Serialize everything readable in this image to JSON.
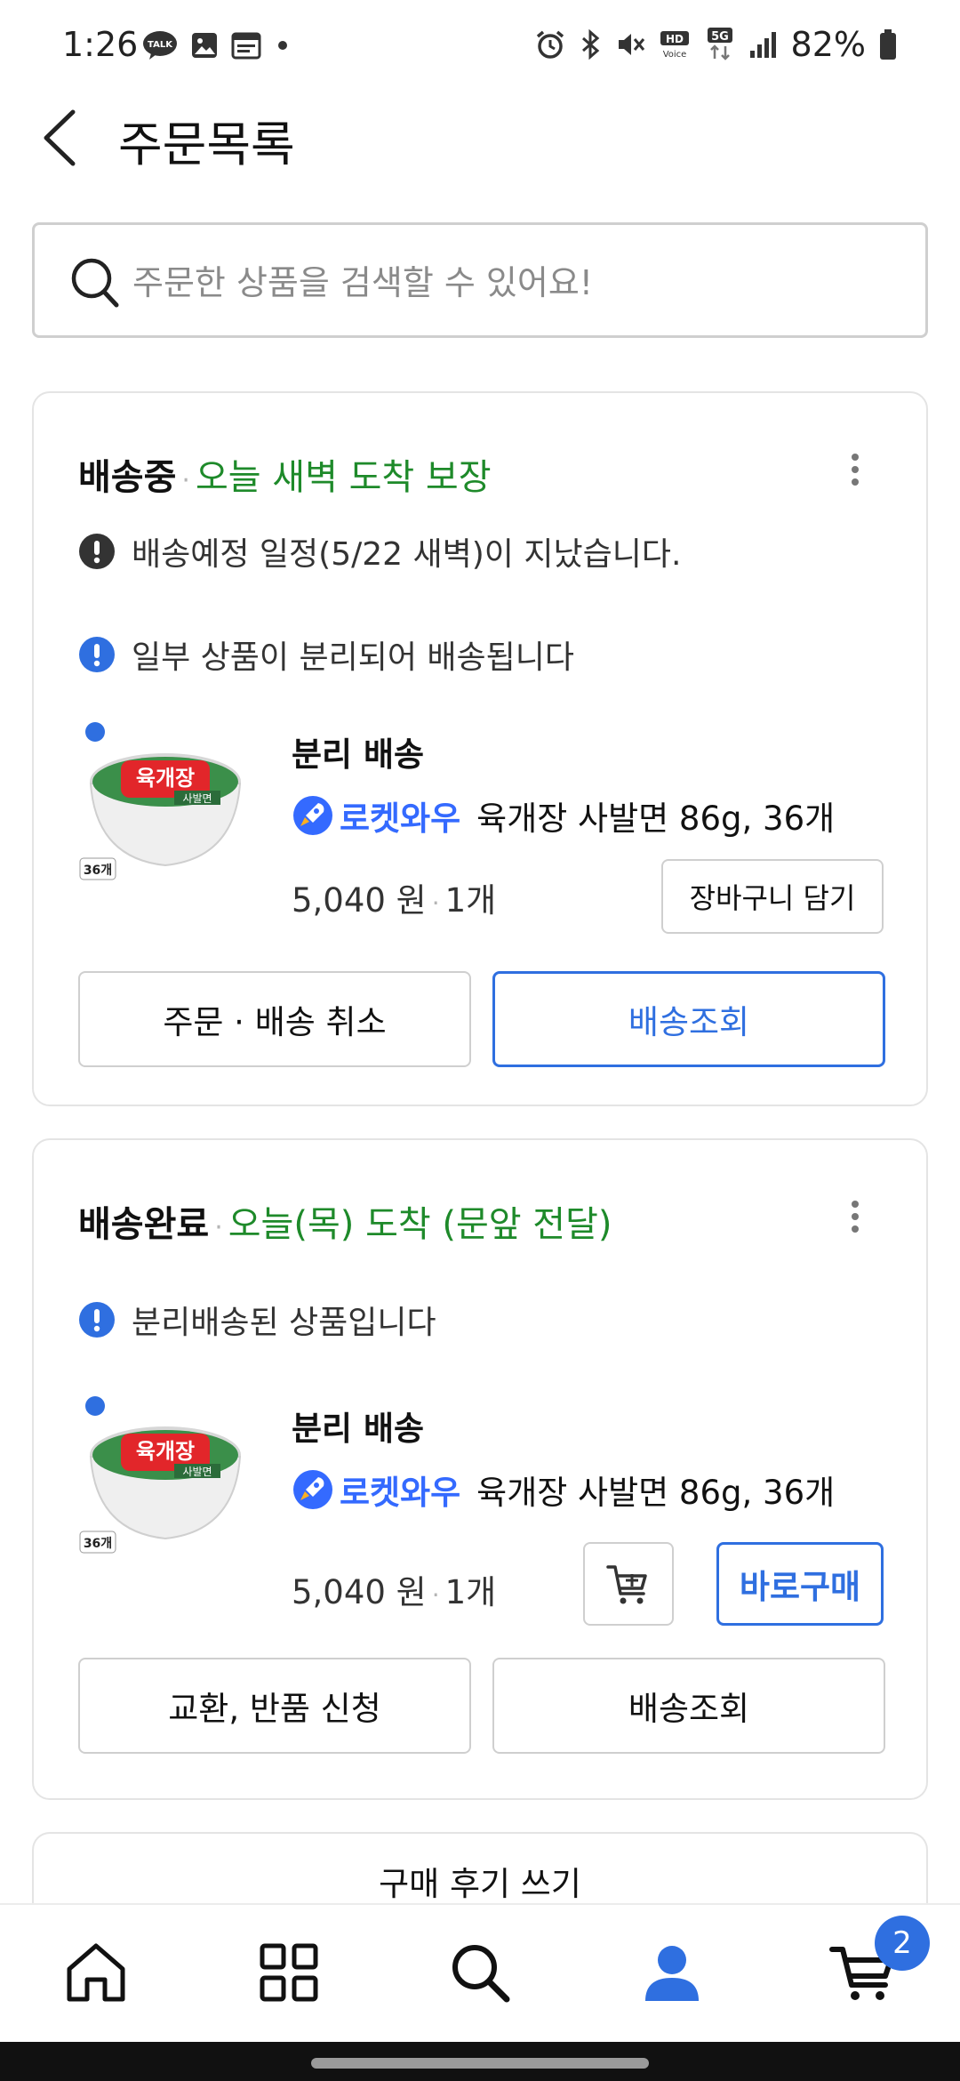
{
  "status_bar": {
    "time": "1:26",
    "battery": "82%",
    "left_icons": [
      "talk-icon",
      "gallery-icon",
      "calendar-icon",
      "dot-icon"
    ],
    "right_icons": [
      "alarm-icon",
      "bluetooth-icon",
      "mute-icon",
      "hd-voice-icon",
      "5g-icon",
      "signal-icon",
      "battery-icon"
    ]
  },
  "header": {
    "title": "주문목록"
  },
  "search": {
    "placeholder": "주문한 상품을 검색할 수 있어요!",
    "value": ""
  },
  "orders": [
    {
      "status": "배송중",
      "status_detail": "오늘 새벽 도착 보장",
      "warning": "배송예정 일정(5/22 새벽)이 지났습니다.",
      "notice": "일부 상품이 분리되어 배송됩니다",
      "item_title": "분리 배송",
      "badge": "로켓와우",
      "product_name": "육개장 사발면 86g, 36개",
      "price": "5,040 원",
      "quantity": "1개",
      "cart_button": "장바구니 담기",
      "actions": [
        "주문 · 배송 취소",
        "배송조회"
      ],
      "thumb_count": "36개"
    },
    {
      "status": "배송완료",
      "status_detail": "오늘(목) 도착 (문앞 전달)",
      "notice": "분리배송된 상품입니다",
      "item_title": "분리 배송",
      "badge": "로켓와우",
      "product_name": "육개장 사발면 86g, 36개",
      "price": "5,040 원",
      "quantity": "1개",
      "buy_now_button": "바로구매",
      "actions": [
        "교환, 반품 신청",
        "배송조회"
      ],
      "thumb_count": "36개"
    }
  ],
  "review_button": "구매 후기 쓰기",
  "bottom_nav": {
    "items": [
      "home-icon",
      "category-icon",
      "search-icon",
      "my-page-icon",
      "cart-icon"
    ],
    "cart_count": "2"
  },
  "colors": {
    "accent": "#2f6fe0",
    "status_green": "#1e8a2a",
    "rocket_blue": "#346aff"
  }
}
